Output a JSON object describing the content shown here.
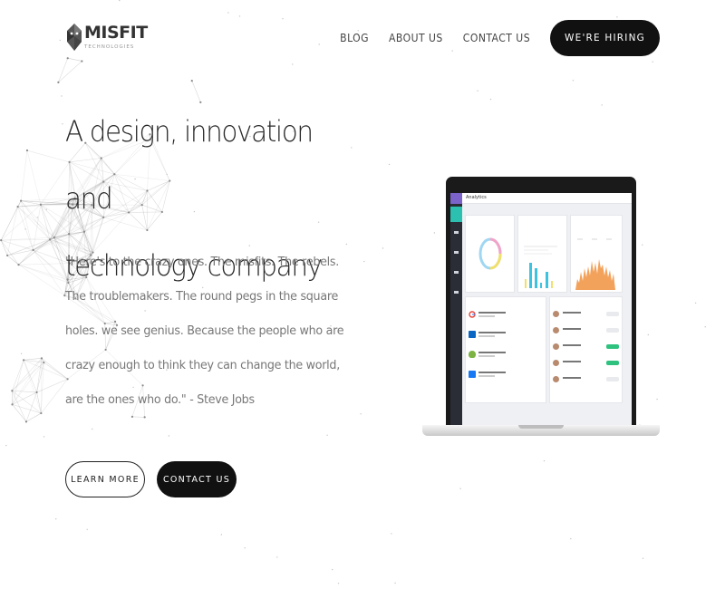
{
  "header": {
    "logo": {
      "word": "MISFIT",
      "tagline": "TECHNOLOGIES"
    },
    "nav": [
      {
        "label": "BLOG"
      },
      {
        "label": "ABOUT US"
      },
      {
        "label": "CONTACT US"
      }
    ],
    "cta_label": "WE'RE HIRING"
  },
  "hero": {
    "title_line1": "A design, innovation and",
    "title_line2": "technology company",
    "quote": "\"Here's to the crazy ones. The misfits. The rebels. The troublemakers. The round pegs in the square holes. we see genius. Because the people who are crazy enough to think they can change the world, are the ones who do.\" - Steve Jobs",
    "learn_more_label": "LEARN MORE",
    "contact_label": "CONTACT US"
  },
  "dashboard": {
    "title": "Analytics",
    "colors": {
      "sidebar": "#2b2d36",
      "sidebar_logo": "#7b63c9",
      "accent_teal": "#2bc0b0",
      "donut_yellow": "#f2df6b",
      "donut_pink": "#f3a3c7",
      "donut_blue": "#9fd7f2",
      "bar_blue": "#3ec3df",
      "area_orange": "#f3a25c",
      "status_green": "#2ec27e"
    }
  }
}
